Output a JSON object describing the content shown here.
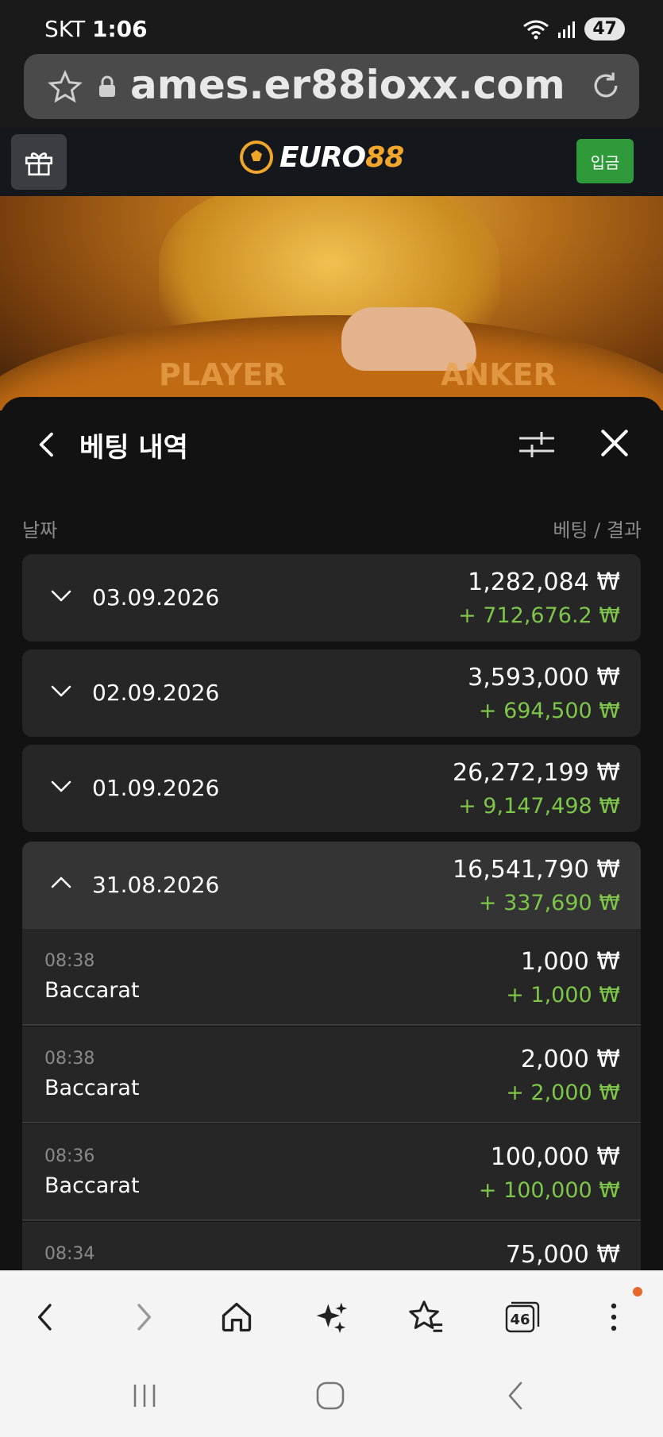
{
  "status_bar": {
    "carrier": "SKT",
    "time": "1:06",
    "battery": "47"
  },
  "browser": {
    "url": "ames.er88ioxx.com",
    "tabs_count": "46"
  },
  "site": {
    "logo_text_a": "EURO",
    "logo_text_b": "88",
    "deposit_label": "입금"
  },
  "hero": {
    "label_player": "PLAYER",
    "label_banker": "ANKER"
  },
  "panel": {
    "title": "베팅 내역",
    "col_date": "날짜",
    "col_bet_result": "베팅 / 결과"
  },
  "days": [
    {
      "date": "03.09.2026",
      "bet": "1,282,084 ₩",
      "result": "+ 712,676.2 ₩"
    },
    {
      "date": "02.09.2026",
      "bet": "3,593,000 ₩",
      "result": "+ 694,500 ₩"
    },
    {
      "date": "01.09.2026",
      "bet": "26,272,199 ₩",
      "result": "+ 9,147,498 ₩"
    },
    {
      "date": "31.08.2026",
      "bet": "16,541,790 ₩",
      "result": "+ 337,690 ₩"
    }
  ],
  "bets": [
    {
      "time": "08:38",
      "game": "Baccarat",
      "amount": "1,000 ₩",
      "result": "+ 1,000 ₩"
    },
    {
      "time": "08:38",
      "game": "Baccarat",
      "amount": "2,000 ₩",
      "result": "+ 2,000 ₩"
    },
    {
      "time": "08:36",
      "game": "Baccarat",
      "amount": "100,000 ₩",
      "result": "+ 100,000 ₩"
    },
    {
      "time": "08:34",
      "game": "",
      "amount": "75,000 ₩",
      "result": ""
    }
  ],
  "colors": {
    "win_green": "#7ec64a",
    "deposit_green": "#2f9a3a",
    "logo_gold": "#f0a62a"
  }
}
